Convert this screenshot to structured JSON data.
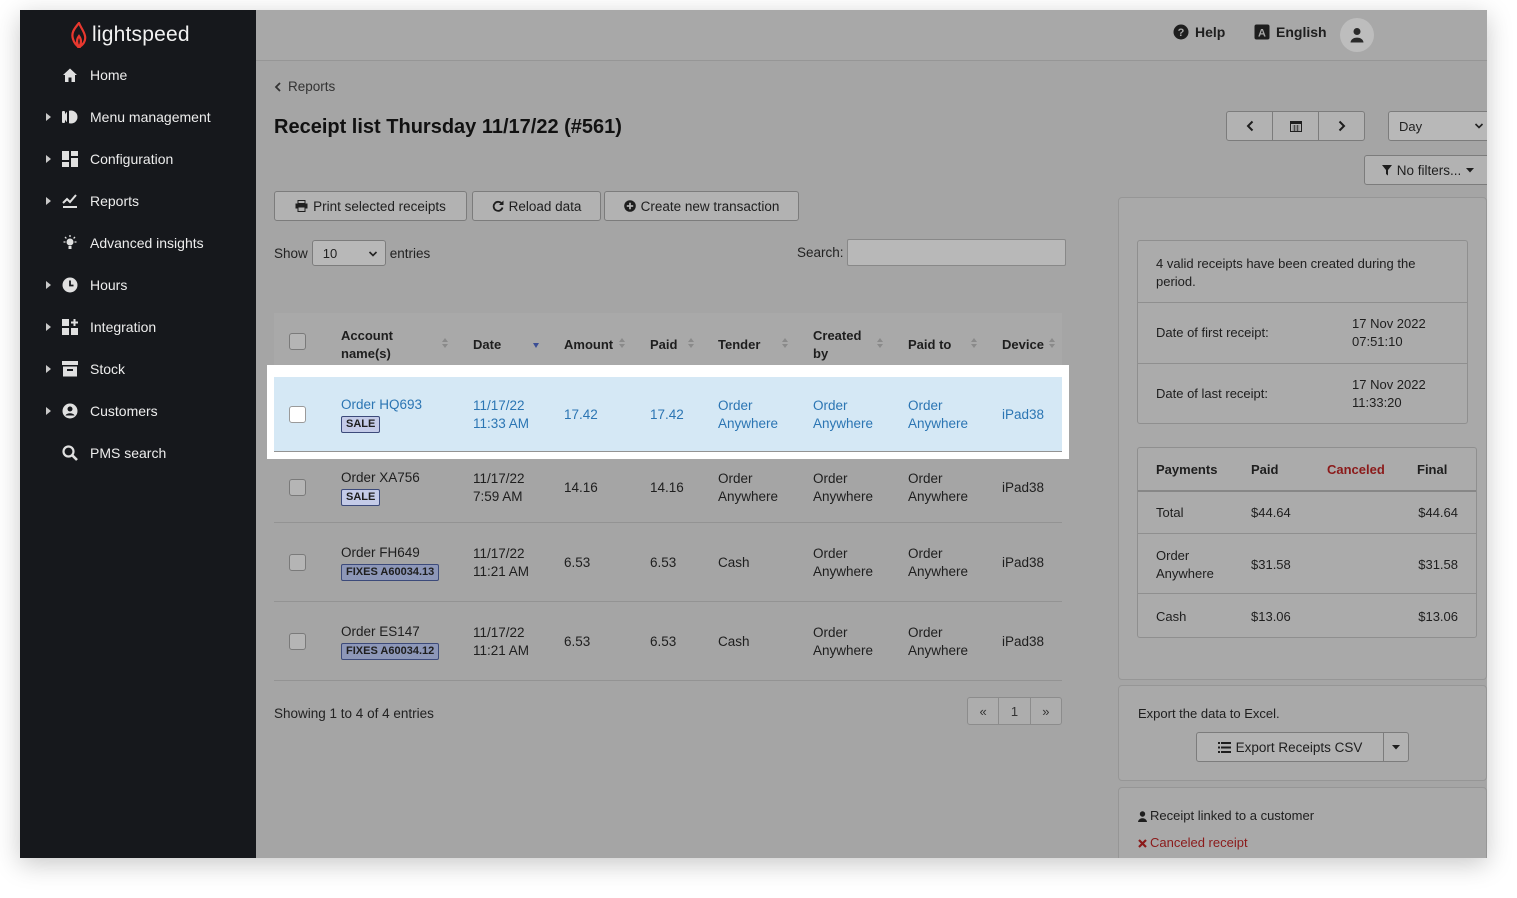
{
  "brand": {
    "name": "lightspeed",
    "accent": "#e8382f"
  },
  "sidebar": {
    "items": [
      {
        "label": "Home",
        "icon": "home-icon",
        "has_caret": false
      },
      {
        "label": "Menu management",
        "icon": "menu-management-icon",
        "has_caret": true
      },
      {
        "label": "Configuration",
        "icon": "configuration-icon",
        "has_caret": true
      },
      {
        "label": "Reports",
        "icon": "reports-icon",
        "has_caret": true
      },
      {
        "label": "Advanced insights",
        "icon": "insights-icon",
        "has_caret": false
      },
      {
        "label": "Hours",
        "icon": "clock-icon",
        "has_caret": true
      },
      {
        "label": "Integration",
        "icon": "integration-icon",
        "has_caret": true
      },
      {
        "label": "Stock",
        "icon": "stock-icon",
        "has_caret": true
      },
      {
        "label": "Customers",
        "icon": "customer-icon",
        "has_caret": true
      },
      {
        "label": "PMS search",
        "icon": "search-icon",
        "has_caret": false
      }
    ]
  },
  "topbar": {
    "help": "Help",
    "language": "English"
  },
  "breadcrumb": "Reports",
  "page_title": "Receipt list Thursday 11/17/22 (#561)",
  "period_select": "Day",
  "filters_button": "No filters...",
  "actions": {
    "print": "Print selected receipts",
    "reload": "Reload data",
    "create": "Create new transaction"
  },
  "length": {
    "show": "Show",
    "value": "10",
    "entries": "entries"
  },
  "search_label": "Search:",
  "table": {
    "headers": {
      "account": "Account name(s)",
      "date": "Date",
      "amount": "Amount",
      "paid": "Paid",
      "tender": "Tender",
      "created_by": "Created by",
      "paid_to": "Paid to",
      "device": "Device"
    },
    "rows": [
      {
        "account": "Order HQ693",
        "badge": "SALE",
        "date": "11/17/22 11:33 AM",
        "amount": "17.42",
        "paid": "17.42",
        "tender": "Order Anywhere",
        "created_by": "Order Anywhere",
        "paid_to": "Order Anywhere",
        "device": "iPad38"
      },
      {
        "account": "Order XA756",
        "badge": "SALE",
        "date": "11/17/22 7:59 AM",
        "amount": "14.16",
        "paid": "14.16",
        "tender": "Order Anywhere",
        "created_by": "Order Anywhere",
        "paid_to": "Order Anywhere",
        "device": "iPad38"
      },
      {
        "account": "Order FH649",
        "badge": "FIXES A60034.13",
        "date": "11/17/22 11:21 AM",
        "amount": "6.53",
        "paid": "6.53",
        "tender": "Cash",
        "created_by": "Order Anywhere",
        "paid_to": "Order Anywhere",
        "device": "iPad38"
      },
      {
        "account": "Order ES147",
        "badge": "FIXES A60034.12",
        "date": "11/17/22 11:21 AM",
        "amount": "6.53",
        "paid": "6.53",
        "tender": "Cash",
        "created_by": "Order Anywhere",
        "paid_to": "Order Anywhere",
        "device": "iPad38"
      }
    ]
  },
  "showing": "Showing 1 to 4 of 4 entries",
  "pagination": {
    "prev": "«",
    "page": "1",
    "next": "»"
  },
  "summary": {
    "valid": "4 valid receipts have been created during the period.",
    "first_label": "Date of first receipt:",
    "first_value": "17 Nov 2022 07:51:10",
    "last_label": "Date of last receipt:",
    "last_value": "17 Nov 2022 11:33:20"
  },
  "payments": {
    "headers": {
      "payments": "Payments",
      "paid": "Paid",
      "canceled": "Canceled",
      "final": "Final"
    },
    "rows": [
      {
        "name": "Total",
        "paid": "$44.64",
        "canceled": "",
        "final": "$44.64"
      },
      {
        "name": "Order Anywhere",
        "paid": "$31.58",
        "canceled": "",
        "final": "$31.58"
      },
      {
        "name": "Cash",
        "paid": "$13.06",
        "canceled": "",
        "final": "$13.06"
      }
    ]
  },
  "export": {
    "text": "Export the data to Excel.",
    "button": "Export Receipts CSV"
  },
  "legend": {
    "linked": "Receipt linked to a customer",
    "canceled": "Canceled receipt"
  },
  "colors": {
    "link": "#2b75b3",
    "canceled": "#8b1a1a",
    "highlight": "#d5e8f5"
  }
}
